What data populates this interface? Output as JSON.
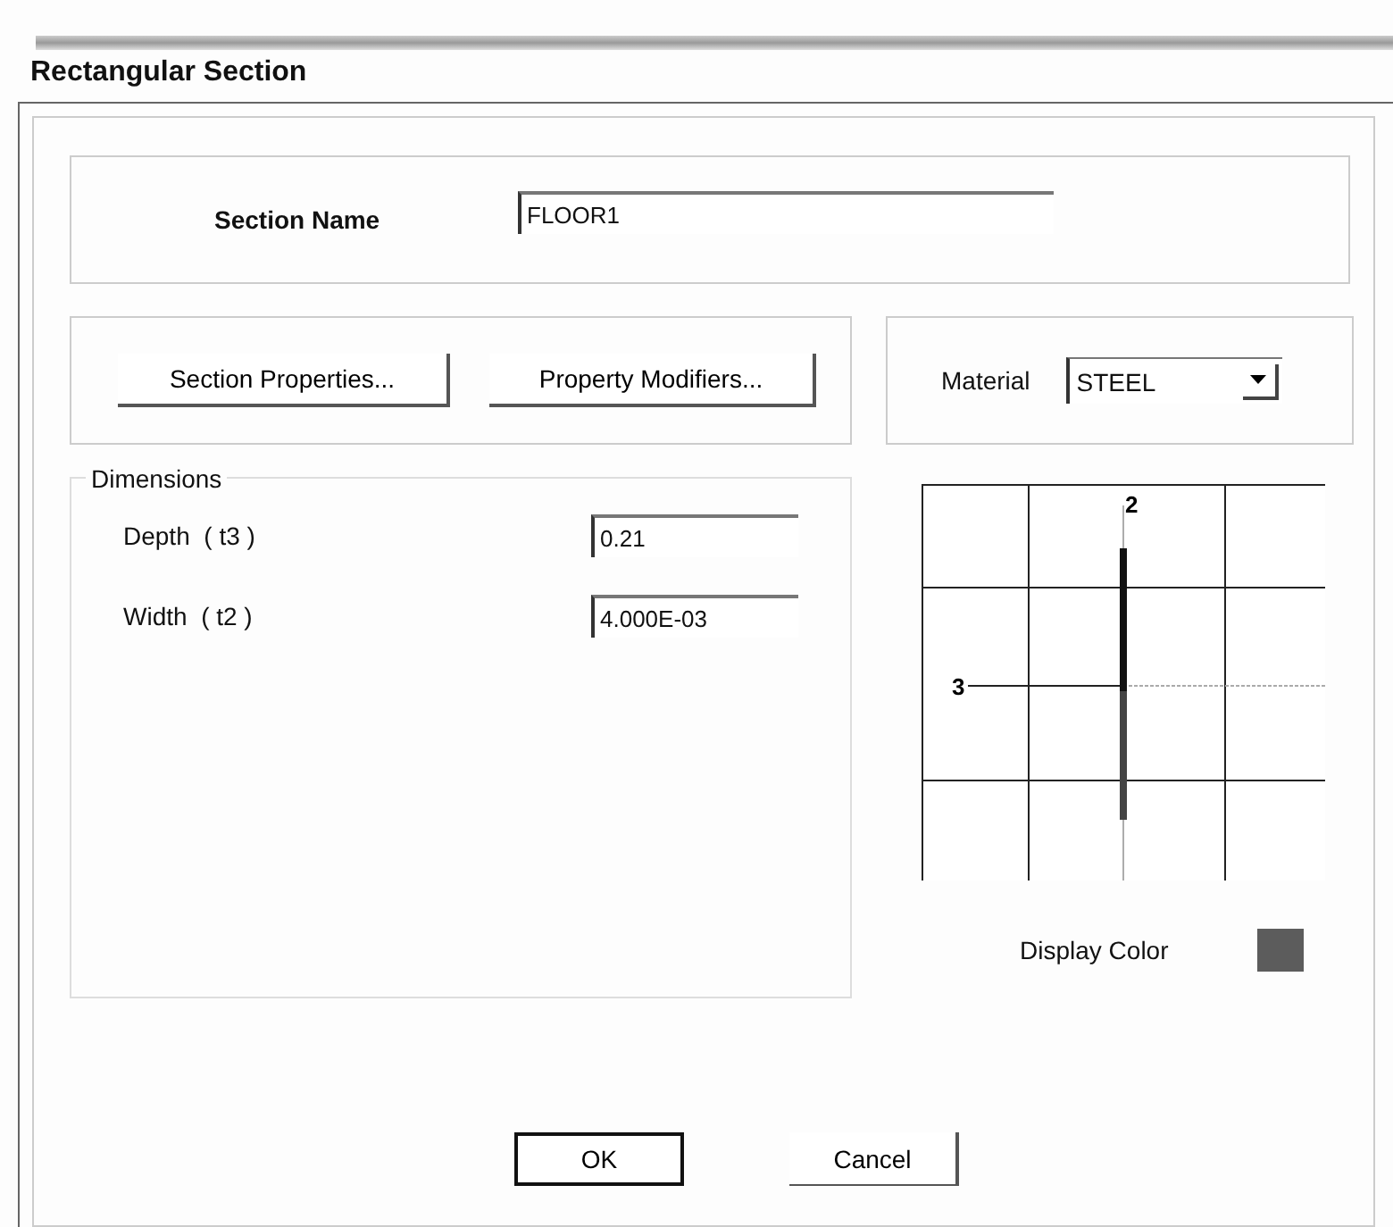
{
  "window": {
    "title": "Rectangular Section"
  },
  "section_name": {
    "label": "Section Name",
    "value": "FLOOR1"
  },
  "property_buttons": [
    {
      "label": "Section Properties..."
    },
    {
      "label": "Property Modifiers..."
    }
  ],
  "material": {
    "label": "Material",
    "value": "STEEL"
  },
  "dimensions": {
    "title": "Dimensions",
    "fields": [
      {
        "label": "Depth  ( t3 )",
        "value": "0.21"
      },
      {
        "label": "Width  ( t2 )",
        "value": "4.000E-03"
      }
    ]
  },
  "preview": {
    "axis_labels": [
      "2",
      "3"
    ]
  },
  "display_color": {
    "label": "Display Color",
    "color": "#5c5c5c"
  },
  "buttons": [
    {
      "label": "OK",
      "default": true
    },
    {
      "label": "Cancel",
      "default": false
    }
  ]
}
